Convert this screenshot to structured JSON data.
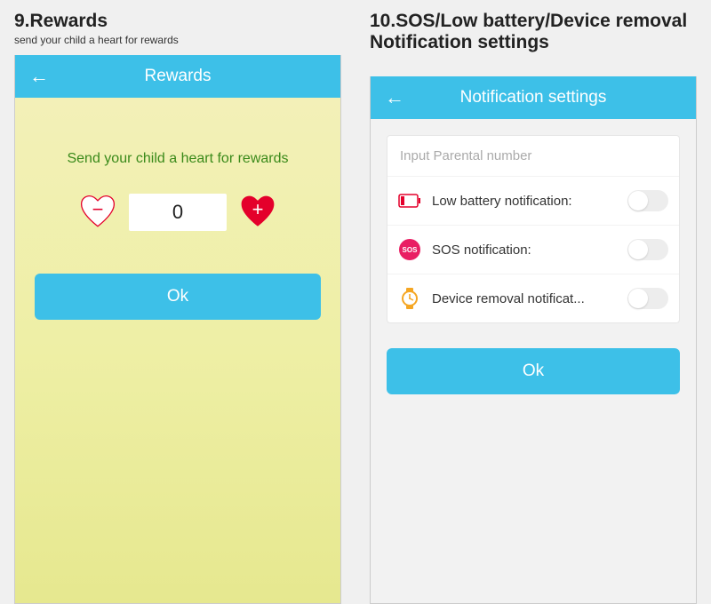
{
  "left": {
    "heading": "9.Rewards",
    "subheading": "send your child a heart for rewards",
    "appbar_title": "Rewards",
    "prompt": "Send your child a heart for rewards",
    "count": "0",
    "ok_label": "Ok"
  },
  "right": {
    "heading": "10.SOS/Low battery/Device removal Notification settings",
    "subheading": "",
    "appbar_title": "Notification settings",
    "input_placeholder": "Input Parental number",
    "rows": [
      {
        "label": "Low battery notification:"
      },
      {
        "label": "SOS notification:"
      },
      {
        "label": "Device removal notificat..."
      }
    ],
    "ok_label": "Ok"
  }
}
